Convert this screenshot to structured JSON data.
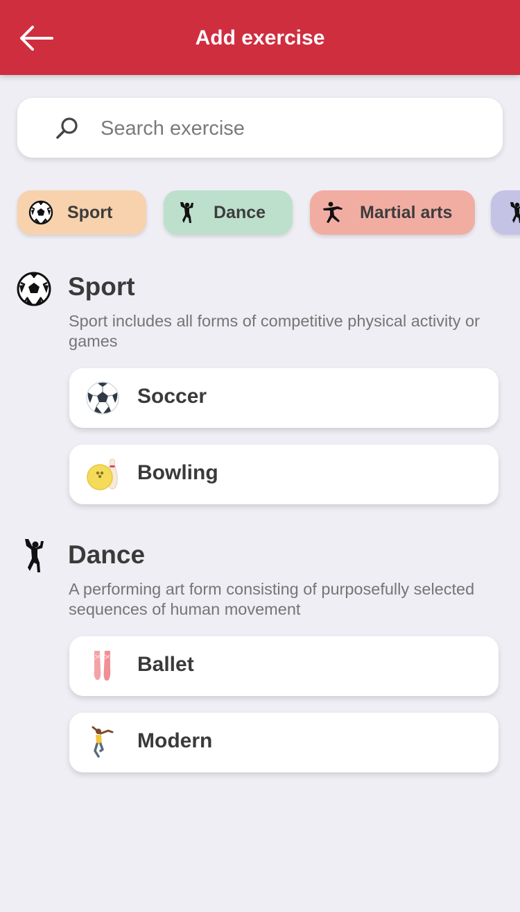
{
  "header": {
    "title": "Add exercise",
    "back_icon": "arrow-left-icon",
    "background": "#cf2e3f"
  },
  "search": {
    "placeholder": "Search exercise",
    "value": "",
    "icon": "search-icon"
  },
  "categories": [
    {
      "label": "Sport",
      "icon": "soccer-ball-icon",
      "color": "#f7d2ad"
    },
    {
      "label": "Dance",
      "icon": "dancer-icon",
      "color": "#bde0cc"
    },
    {
      "label": "Martial arts",
      "icon": "martial-arts-icon",
      "color": "#f2ada3"
    },
    {
      "label": "",
      "icon": "person-icon",
      "color": "#c4c3e6"
    }
  ],
  "sections": [
    {
      "title": "Sport",
      "icon": "soccer-ball-icon",
      "description": "Sport includes all forms of competitive physical activity or games",
      "exercises": [
        {
          "label": "Soccer",
          "icon": "soccer-ball-icon"
        },
        {
          "label": "Bowling",
          "icon": "bowling-icon"
        }
      ]
    },
    {
      "title": "Dance",
      "icon": "dancer-icon",
      "description": "A performing art form consisting of purposefully selected sequences of human movement",
      "exercises": [
        {
          "label": "Ballet",
          "icon": "ballet-shoes-icon"
        },
        {
          "label": "Modern",
          "icon": "modern-dancer-icon"
        }
      ]
    }
  ]
}
